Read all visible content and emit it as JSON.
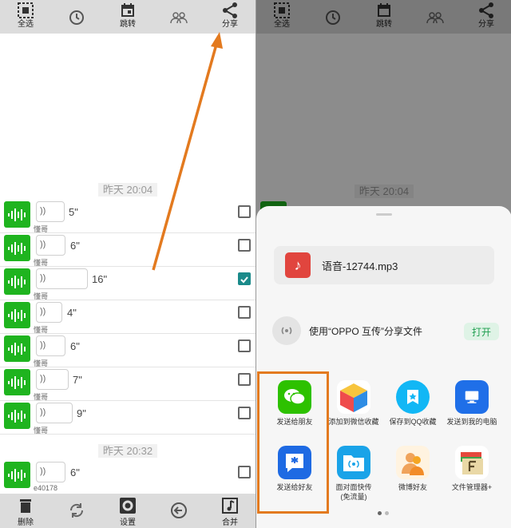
{
  "toolbar": {
    "items": [
      {
        "label": "全选",
        "icon": "select-all-icon"
      },
      {
        "label": "",
        "icon": "clock-icon"
      },
      {
        "label": "跳转",
        "icon": "calendar-icon"
      },
      {
        "label": "",
        "icon": "contacts-icon"
      },
      {
        "label": "分享",
        "icon": "share-icon"
      }
    ]
  },
  "chat": {
    "stamp1": "昨天 20:04",
    "stamp2": "昨天 20:32",
    "messages": [
      {
        "duration": "5\"",
        "sender": "懂哥",
        "checked": false
      },
      {
        "duration": "6\"",
        "sender": "懂哥",
        "checked": false
      },
      {
        "duration": "16\"",
        "sender": "懂哥",
        "checked": true
      },
      {
        "duration": "4\"",
        "sender": "懂哥",
        "checked": false
      },
      {
        "duration": "6\"",
        "sender": "懂哥",
        "checked": false
      },
      {
        "duration": "7\"",
        "sender": "懂哥",
        "checked": false
      },
      {
        "duration": "9\"",
        "sender": "懂哥",
        "checked": false
      },
      {
        "duration": "6\"",
        "sender": "e40178",
        "checked": false
      }
    ]
  },
  "bottombar": {
    "items": [
      {
        "label": "删除",
        "icon": "trash-icon"
      },
      {
        "label": "",
        "icon": "refresh-icon"
      },
      {
        "label": "设置",
        "icon": "gear-icon"
      },
      {
        "label": "",
        "icon": "back-arrow-icon"
      },
      {
        "label": "合并",
        "icon": "music-note-icon"
      }
    ]
  },
  "share_sheet": {
    "file_name": "语音-12744.mp3",
    "oppo_text": "使用“OPPO 互传”分享文件",
    "open_label": "打开",
    "apps": [
      {
        "label": "发送给朋友",
        "icon": "wechat-icon",
        "color": "#2dc100"
      },
      {
        "label": "添加到微信收藏",
        "icon": "cube-icon",
        "color": "#ffffff"
      },
      {
        "label": "保存到QQ收藏",
        "icon": "qq-favorite-icon",
        "color": "#12b7f5"
      },
      {
        "label": "发送到我的电脑",
        "icon": "computer-icon",
        "color": "#1f6fe8"
      },
      {
        "label": "发送给好友",
        "icon": "qq-friend-icon",
        "color": "#1e6ae3"
      },
      {
        "label": "面对面快传\n(免流量)",
        "icon": "folder-transfer-icon",
        "color": "#1aa3e8"
      },
      {
        "label": "微博好友",
        "icon": "weibo-friend-icon",
        "color": "#f5a623"
      },
      {
        "label": "文件管理器+",
        "icon": "file-manager-icon",
        "color": "#e9d8a6"
      }
    ]
  }
}
